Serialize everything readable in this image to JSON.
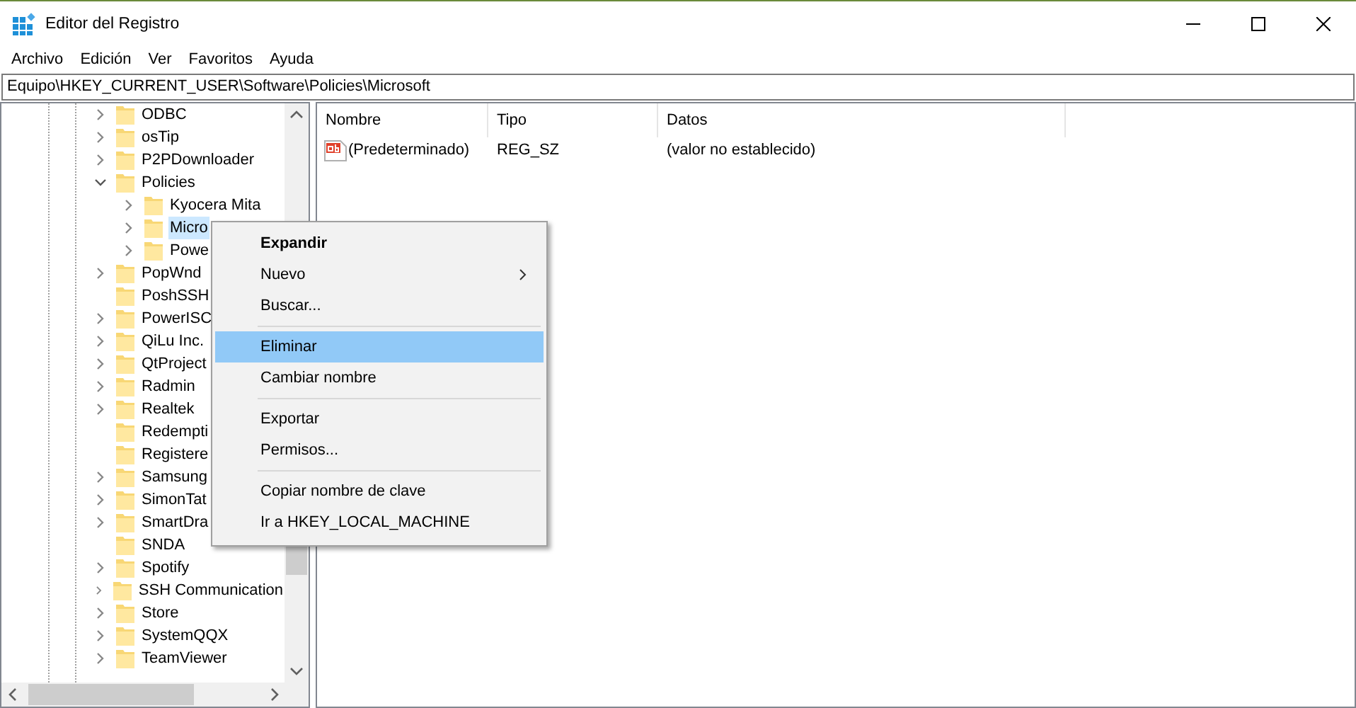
{
  "window": {
    "title": "Editor del Registro"
  },
  "menu": [
    "Archivo",
    "Edición",
    "Ver",
    "Favoritos",
    "Ayuda"
  ],
  "address": "Equipo\\HKEY_CURRENT_USER\\Software\\Policies\\Microsoft",
  "tree": [
    {
      "label": "ODBC",
      "expanded": false,
      "selected": false
    },
    {
      "label": "osTip",
      "expanded": false,
      "selected": false
    },
    {
      "label": "P2PDownloader",
      "expanded": false,
      "selected": false
    },
    {
      "label": "Policies",
      "expanded": true,
      "selected": false,
      "children": [
        {
          "label": "Kyocera Mita",
          "expanded": false,
          "selected": false
        },
        {
          "label": "Micro",
          "expanded": false,
          "selected": true
        },
        {
          "label": "Powe",
          "expanded": false,
          "selected": false
        }
      ]
    },
    {
      "label": "PopWnd",
      "expanded": false,
      "selected": false
    },
    {
      "label": "PoshSSH",
      "selected": false
    },
    {
      "label": "PowerISC",
      "expanded": false,
      "selected": false
    },
    {
      "label": "QiLu Inc.",
      "expanded": false,
      "selected": false
    },
    {
      "label": "QtProject",
      "expanded": false,
      "selected": false
    },
    {
      "label": "Radmin",
      "expanded": false,
      "selected": false
    },
    {
      "label": "Realtek",
      "expanded": false,
      "selected": false
    },
    {
      "label": "Redempti",
      "selected": false
    },
    {
      "label": "Registere",
      "selected": false
    },
    {
      "label": "Samsung",
      "expanded": false,
      "selected": false
    },
    {
      "label": "SimonTat",
      "expanded": false,
      "selected": false
    },
    {
      "label": "SmartDra",
      "expanded": false,
      "selected": false
    },
    {
      "label": "SNDA",
      "selected": false
    },
    {
      "label": "Spotify",
      "expanded": false,
      "selected": false
    },
    {
      "label": "SSH Communication",
      "expanded": false,
      "selected": false
    },
    {
      "label": "Store",
      "expanded": false,
      "selected": false
    },
    {
      "label": "SystemQQX",
      "expanded": false,
      "selected": false
    },
    {
      "label": "TeamViewer",
      "expanded": false,
      "selected": false
    }
  ],
  "list": {
    "columns": [
      "Nombre",
      "Tipo",
      "Datos"
    ],
    "rows": [
      {
        "name": "(Predeterminado)",
        "type": "REG_SZ",
        "data": "(valor no establecido)"
      }
    ]
  },
  "context_menu": [
    {
      "kind": "item",
      "label": "Expandir",
      "default": true,
      "submenu": false,
      "selected": false
    },
    {
      "kind": "item",
      "label": "Nuevo",
      "default": false,
      "submenu": true,
      "selected": false
    },
    {
      "kind": "item",
      "label": "Buscar...",
      "default": false,
      "submenu": false,
      "selected": false
    },
    {
      "kind": "separator"
    },
    {
      "kind": "item",
      "label": "Eliminar",
      "default": false,
      "submenu": false,
      "selected": true
    },
    {
      "kind": "item",
      "label": "Cambiar nombre",
      "default": false,
      "submenu": false,
      "selected": false
    },
    {
      "kind": "separator"
    },
    {
      "kind": "item",
      "label": "Exportar",
      "default": false,
      "submenu": false,
      "selected": false
    },
    {
      "kind": "item",
      "label": "Permisos...",
      "default": false,
      "submenu": false,
      "selected": false
    },
    {
      "kind": "separator"
    },
    {
      "kind": "item",
      "label": "Copiar nombre de clave",
      "default": false,
      "submenu": false,
      "selected": false
    },
    {
      "kind": "item",
      "label": "Ir a HKEY_LOCAL_MACHINE",
      "default": false,
      "submenu": false,
      "selected": false
    }
  ]
}
